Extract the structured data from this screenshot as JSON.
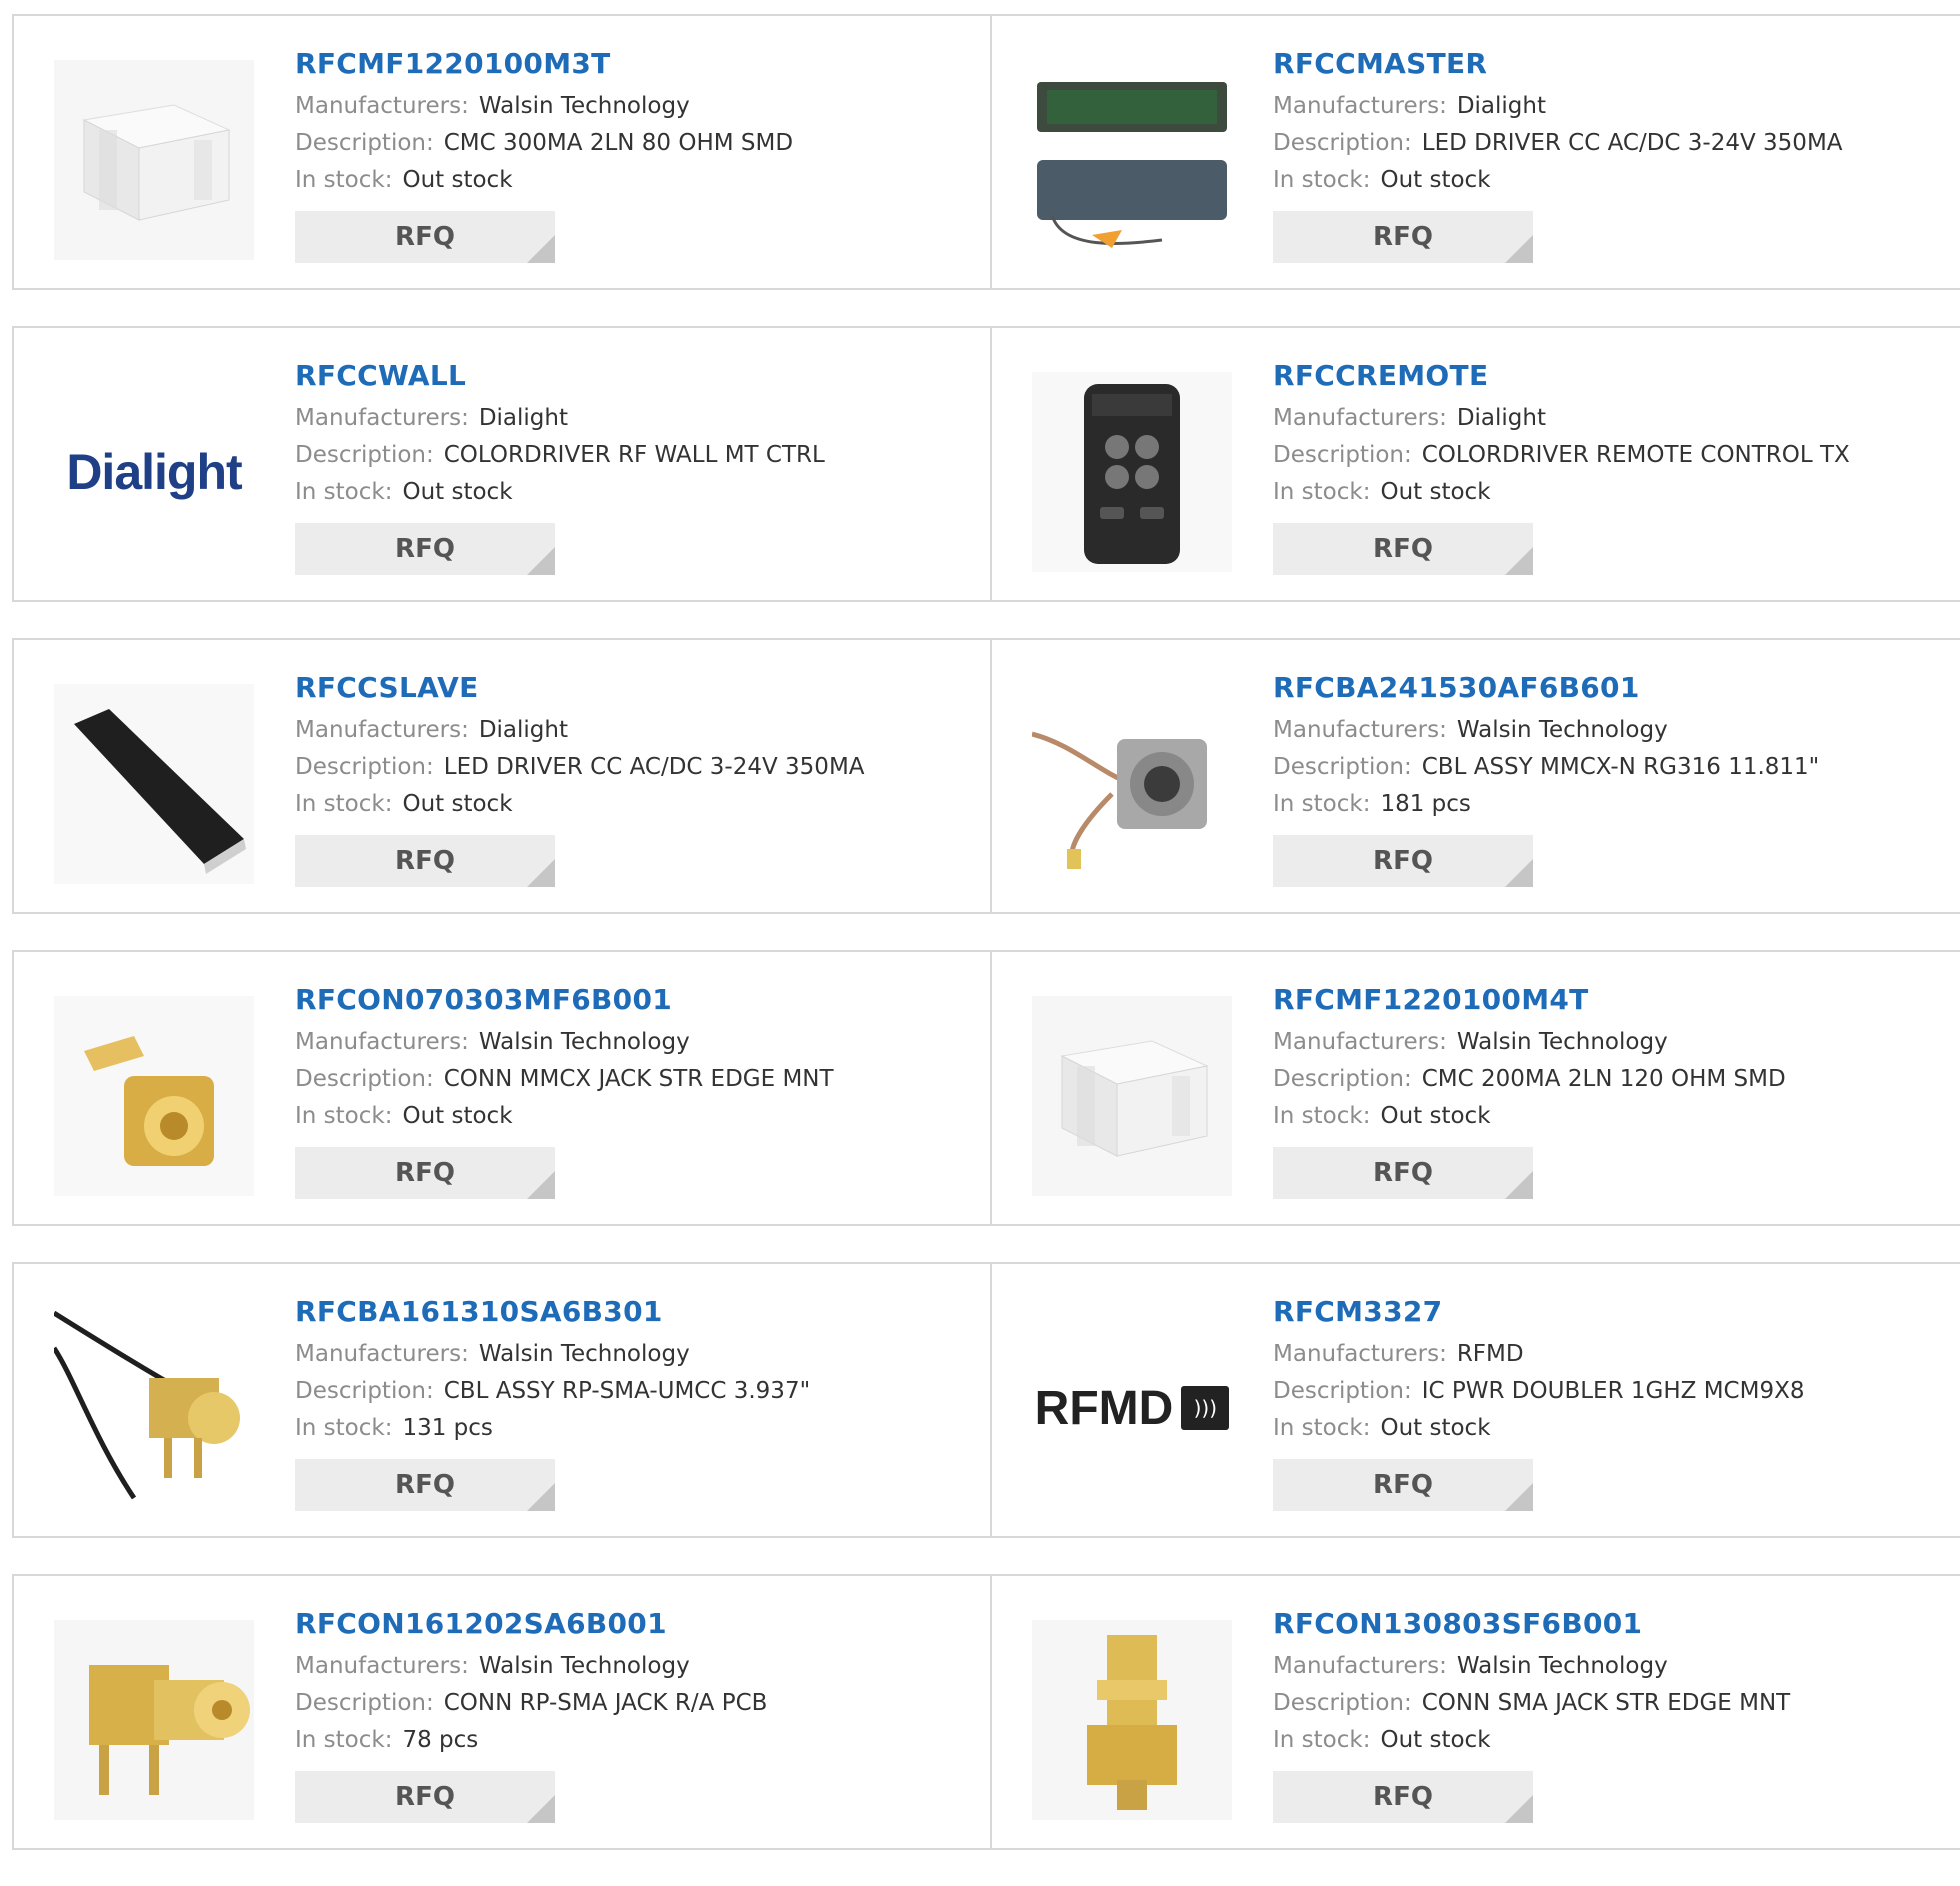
{
  "labels": {
    "manufacturers": "Manufacturers:",
    "description": "Description:",
    "in_stock": "In stock:",
    "rfq": "RFQ"
  },
  "colors": {
    "link": "#1e6bb8",
    "border": "#d8d8d8",
    "button_bg": "#ececec"
  },
  "products": [
    {
      "name": "RFCMF1220100M3T",
      "manufacturer": "Walsin Technology",
      "description": "CMC 300MA 2LN 80 OHM SMD",
      "stock": "Out stock",
      "image": "white-smd-chip-icon"
    },
    {
      "name": "RFCCMASTER",
      "manufacturer": "Dialight",
      "description": "LED DRIVER CC AC/DC 3-24V 350MA",
      "stock": "Out stock",
      "image": "led-driver-module-icon"
    },
    {
      "name": "RFCCWALL",
      "manufacturer": "Dialight",
      "description": "COLORDRIVER RF WALL MT CTRL",
      "stock": "Out stock",
      "image": "dialight-logo",
      "logo_text": "Dialight"
    },
    {
      "name": "RFCCREMOTE",
      "manufacturer": "Dialight",
      "description": "COLORDRIVER REMOTE CONTROL TX",
      "stock": "Out stock",
      "image": "remote-control-icon"
    },
    {
      "name": "RFCCSLAVE",
      "manufacturer": "Dialight",
      "description": "LED DRIVER CC AC/DC 3-24V 350MA",
      "stock": "Out stock",
      "image": "black-driver-module-icon"
    },
    {
      "name": "RFCBA241530AF6B601",
      "manufacturer": "Walsin Technology",
      "description": "CBL ASSY MMCX-N RG316 11.811\"",
      "stock": "181 pcs",
      "image": "cable-assembly-n-connector-icon"
    },
    {
      "name": "RFCON070303MF6B001",
      "manufacturer": "Walsin Technology",
      "description": "CONN MMCX JACK STR EDGE MNT",
      "stock": "Out stock",
      "image": "gold-mmcx-connector-icon"
    },
    {
      "name": "RFCMF1220100M4T",
      "manufacturer": "Walsin Technology",
      "description": "CMC 200MA 2LN 120 OHM SMD",
      "stock": "Out stock",
      "image": "white-smd-chip-icon"
    },
    {
      "name": "RFCBA161310SA6B301",
      "manufacturer": "Walsin Technology",
      "description": "CBL ASSY RP-SMA-UMCC 3.937\"",
      "stock": "131 pcs",
      "image": "cable-sma-connector-icon"
    },
    {
      "name": "RFCM3327",
      "manufacturer": "RFMD",
      "description": "IC PWR DOUBLER 1GHZ MCM9X8",
      "stock": "Out stock",
      "image": "rfmd-logo",
      "logo_text": "RFMD"
    },
    {
      "name": "RFCON161202SA6B001",
      "manufacturer": "Walsin Technology",
      "description": "CONN RP-SMA JACK R/A PCB",
      "stock": "78 pcs",
      "image": "gold-sma-right-angle-icon"
    },
    {
      "name": "RFCON130803SF6B001",
      "manufacturer": "Walsin Technology",
      "description": "CONN SMA JACK STR EDGE MNT",
      "stock": "Out stock",
      "image": "gold-sma-straight-icon"
    }
  ]
}
